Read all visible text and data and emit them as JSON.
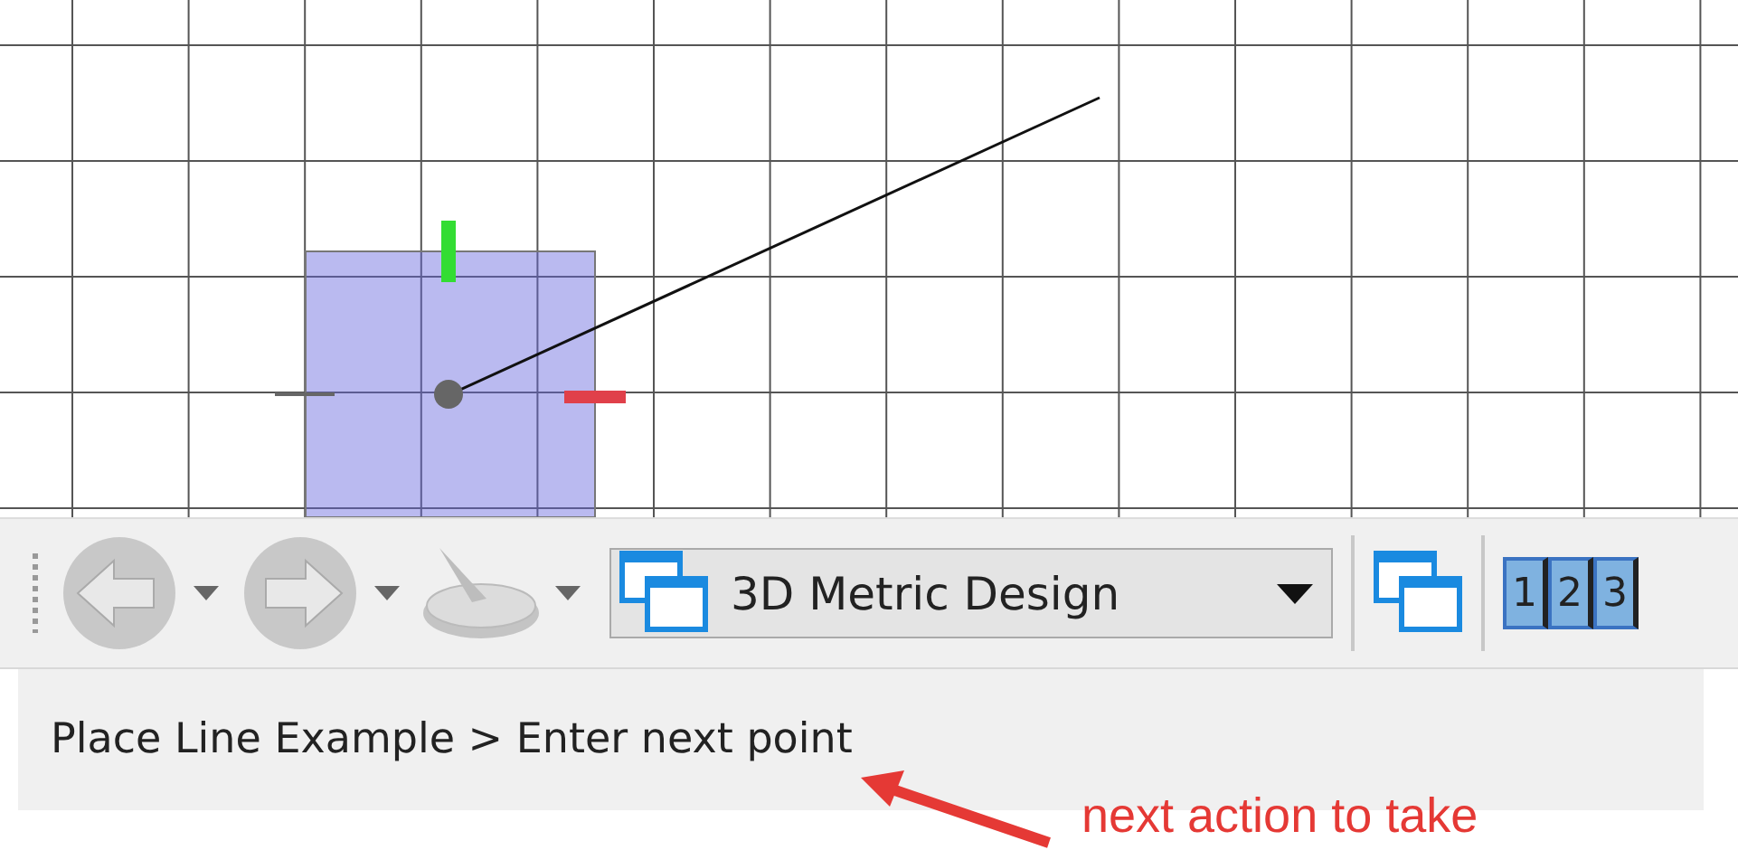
{
  "toolbar": {
    "view_dropdown": {
      "value": "3D Metric Design"
    },
    "view_buttons": [
      "1",
      "2",
      "3"
    ]
  },
  "status_bar": {
    "prompt": "Place Line Example > Enter next point"
  },
  "annotation": {
    "text": "next action to take"
  }
}
